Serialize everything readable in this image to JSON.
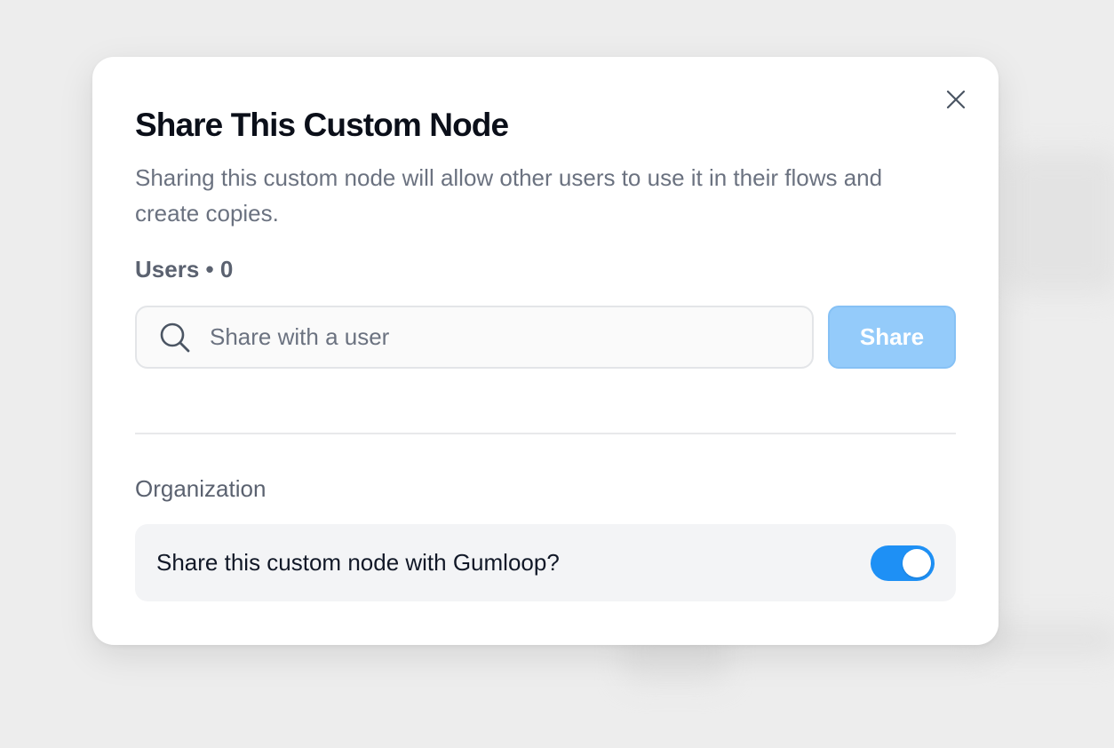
{
  "dialog": {
    "title": "Share This Custom Node",
    "description": "Sharing this custom node will allow other users to use it in their flows and create copies.",
    "close_icon": "close-icon"
  },
  "users": {
    "label": "Users • 0",
    "count": 0,
    "search": {
      "placeholder": "Share with a user",
      "value": "",
      "icon": "search-icon"
    },
    "share_button": {
      "label": "Share",
      "enabled": false
    }
  },
  "organization": {
    "label": "Organization",
    "toggle_label": "Share this custom node with Gumloop?",
    "toggle_on": true
  },
  "colors": {
    "accent": "#1e90f5",
    "share_button_disabled": "#94cbfa",
    "title": "#0b0f19",
    "muted_text": "#6b7280"
  }
}
